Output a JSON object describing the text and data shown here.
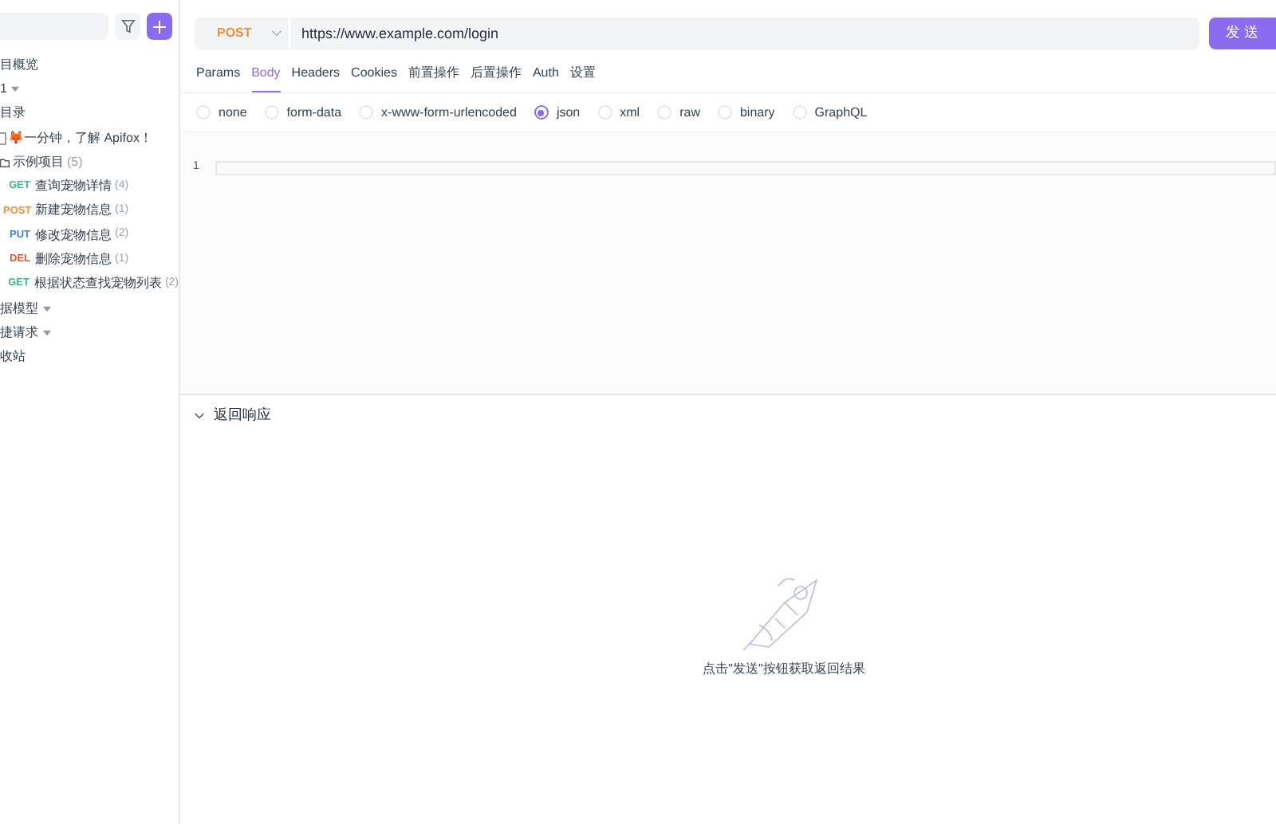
{
  "sidebar": {
    "items": [
      {
        "kind": "text",
        "label": "目概览"
      },
      {
        "kind": "dropdown",
        "label": "1"
      },
      {
        "kind": "text",
        "label": "目录"
      },
      {
        "kind": "doc",
        "label": "🦊一分钟，了解 Apifox！"
      },
      {
        "kind": "folder",
        "label": "示例项目",
        "count": "(5)",
        "children": [
          {
            "method": "GET",
            "label": "查询宠物详情",
            "count": "(4)"
          },
          {
            "method": "POST",
            "label": "新建宠物信息",
            "count": "(1)"
          },
          {
            "method": "PUT",
            "label": "修改宠物信息",
            "count": "(2)"
          },
          {
            "method": "DEL",
            "label": "删除宠物信息",
            "count": "(1)"
          },
          {
            "method": "GET",
            "label": "根据状态查找宠物列表",
            "count": "(2)"
          }
        ]
      },
      {
        "kind": "dropdown",
        "label": "据模型"
      },
      {
        "kind": "dropdown",
        "label": "捷请求"
      },
      {
        "kind": "text",
        "label": "收站"
      }
    ]
  },
  "request": {
    "method": "POST",
    "url": "https://www.example.com/login",
    "send": "发 送",
    "tabs": [
      {
        "label": "Params",
        "selected": false
      },
      {
        "label": "Body",
        "selected": true
      },
      {
        "label": "Headers",
        "selected": false
      },
      {
        "label": "Cookies",
        "selected": false
      },
      {
        "label": "前置操作",
        "selected": false
      },
      {
        "label": "后置操作",
        "selected": false
      },
      {
        "label": "Auth",
        "selected": false
      },
      {
        "label": "设置",
        "selected": false
      }
    ],
    "body_types": [
      {
        "label": "none",
        "selected": false
      },
      {
        "label": "form-data",
        "selected": false
      },
      {
        "label": "x-www-form-urlencoded",
        "selected": false
      },
      {
        "label": "json",
        "selected": true
      },
      {
        "label": "xml",
        "selected": false
      },
      {
        "label": "raw",
        "selected": false
      },
      {
        "label": "binary",
        "selected": false
      },
      {
        "label": "GraphQL",
        "selected": false
      }
    ],
    "editor": {
      "line_numbers": [
        "1"
      ]
    }
  },
  "response": {
    "title": "返回响应",
    "expanded": true,
    "empty_text": "点击\"发送\"按钮获取返回结果"
  }
}
